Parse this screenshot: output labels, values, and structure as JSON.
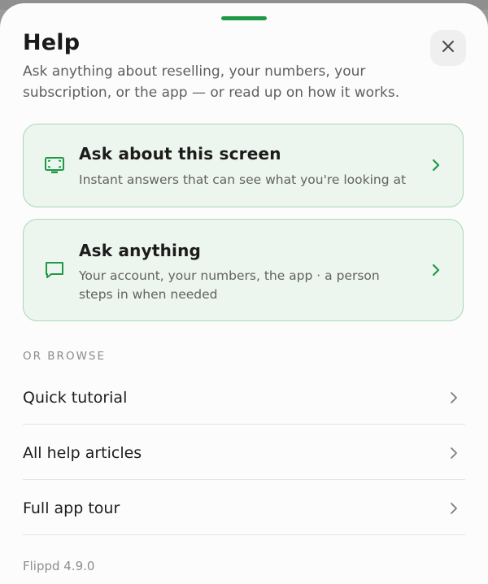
{
  "sheet": {
    "title": "Help",
    "subtitle": "Ask anything about reselling, your numbers, your subscription, or the app — or read up on how it works.",
    "close_icon": "close-icon"
  },
  "cards": [
    {
      "icon": "screen-capture-icon",
      "title": "Ask about this screen",
      "description": "Instant answers that can see what you're looking at"
    },
    {
      "icon": "chat-bubble-icon",
      "title": "Ask anything",
      "description": "Your account, your numbers, the app · a person steps in when needed"
    }
  ],
  "browse": {
    "label": "OR BROWSE",
    "items": [
      {
        "label": "Quick tutorial"
      },
      {
        "label": "All help articles"
      },
      {
        "label": "Full app tour"
      }
    ]
  },
  "footer": {
    "version": "Flippd 4.9.0"
  },
  "colors": {
    "accent": "#1e9a47",
    "card_background": "#ecf5ee",
    "card_border": "#a9d8b6",
    "text_primary": "#1a1a1a",
    "text_secondary": "#5f5f5f"
  }
}
